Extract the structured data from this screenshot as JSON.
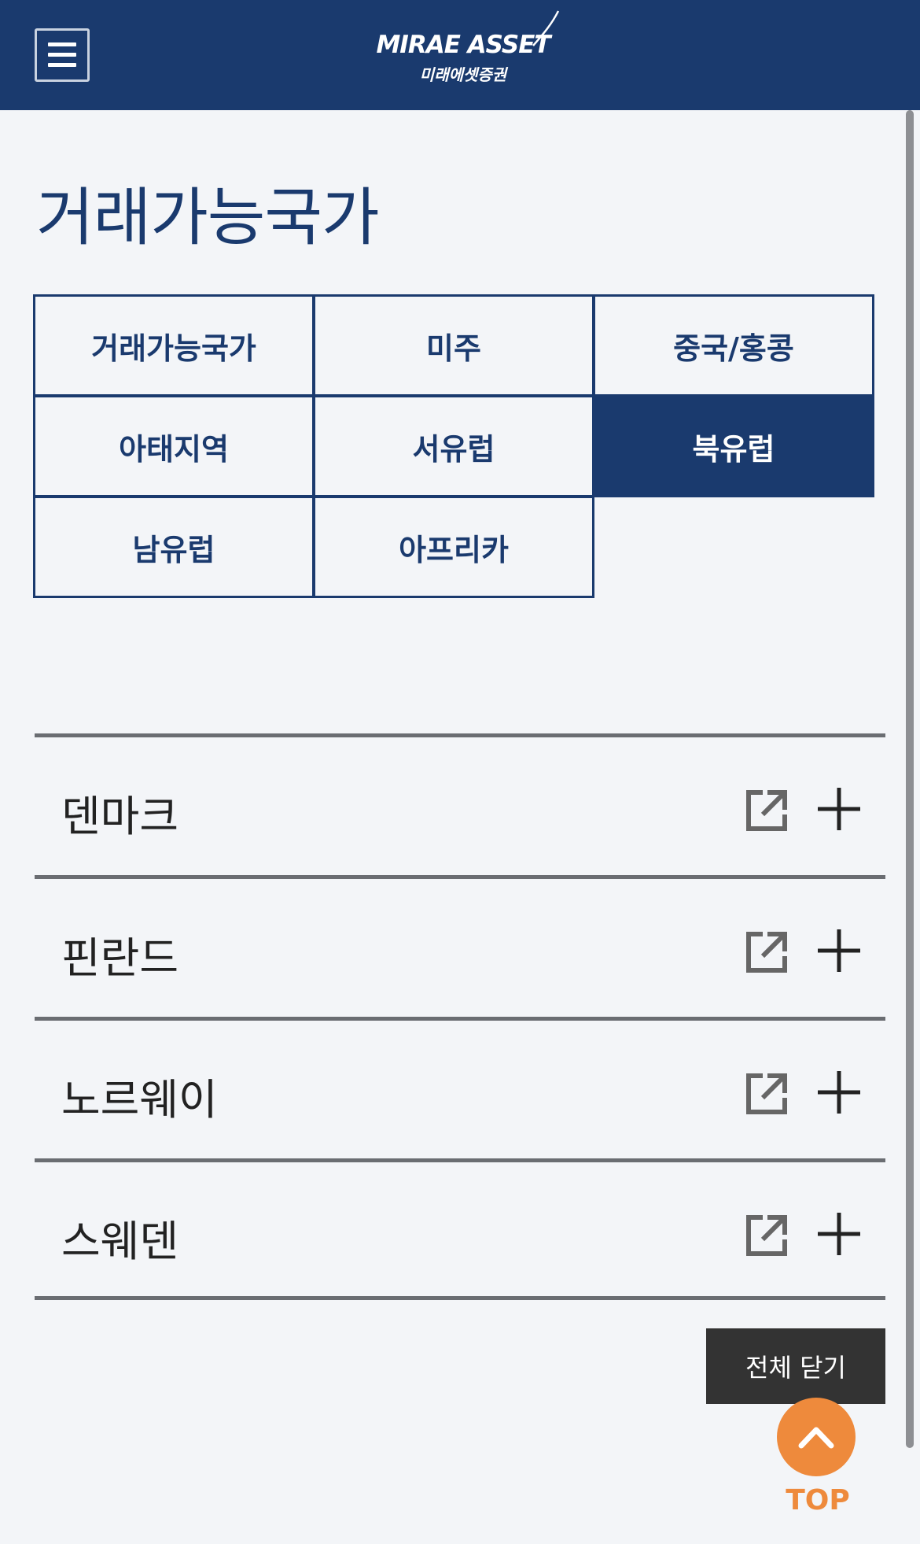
{
  "header": {
    "logo_en": "MIRAE ASSET",
    "logo_ko": "미래에셋증권"
  },
  "page": {
    "title": "거래가능국가"
  },
  "tabs": [
    {
      "label": "거래가능국가",
      "active": false
    },
    {
      "label": "미주",
      "active": false
    },
    {
      "label": "중국/홍콩",
      "active": false
    },
    {
      "label": "아태지역",
      "active": false
    },
    {
      "label": "서유럽",
      "active": false
    },
    {
      "label": "북유럽",
      "active": true
    },
    {
      "label": "남유럽",
      "active": false
    },
    {
      "label": "아프리카",
      "active": false
    }
  ],
  "countries": [
    {
      "name": "덴마크"
    },
    {
      "name": "핀란드"
    },
    {
      "name": "노르웨이"
    },
    {
      "name": "스웨덴"
    }
  ],
  "buttons": {
    "close_all": "전체 닫기",
    "top": "TOP"
  },
  "colors": {
    "brand": "#1a3a6e",
    "accent": "#ee8a3c",
    "background": "#f3f5f8"
  }
}
